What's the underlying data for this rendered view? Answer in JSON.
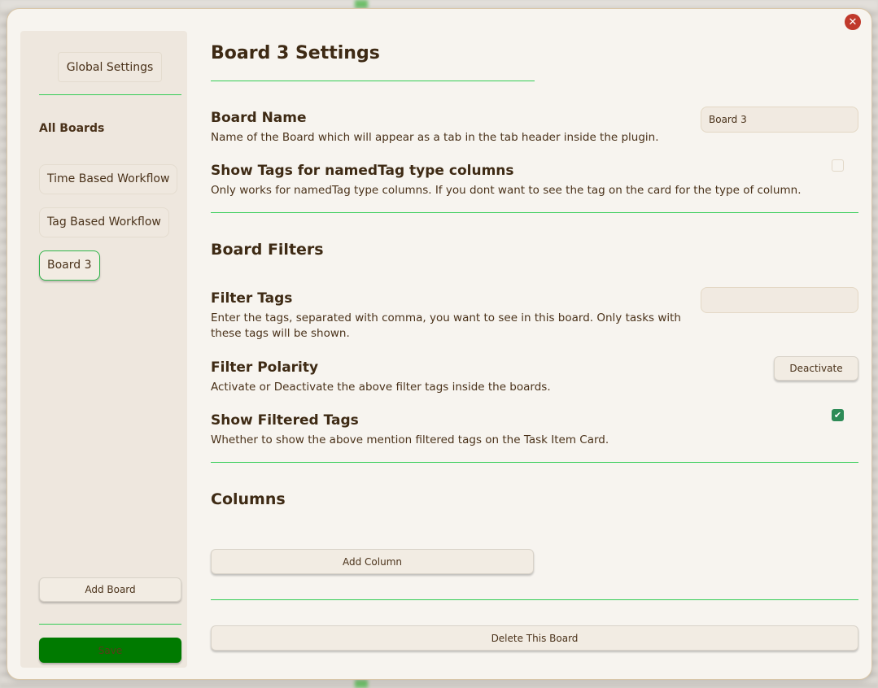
{
  "modal": {
    "close_label": "✕"
  },
  "sidebar": {
    "global_settings_label": "Global Settings",
    "all_boards_heading": "All Boards",
    "boards": [
      {
        "label": "Time Based Workflow",
        "active": false
      },
      {
        "label": "Tag Based Workflow",
        "active": false
      },
      {
        "label": "Board 3",
        "active": true
      }
    ],
    "add_board_label": "Add Board",
    "save_label": "Save"
  },
  "main": {
    "title": "Board 3 Settings",
    "board_name": {
      "name": "Board Name",
      "desc": "Name of the Board which will appear as a tab in the tab header inside the plugin.",
      "value": "Board 3"
    },
    "show_tags": {
      "name": "Show Tags for namedTag type columns",
      "desc": "Only works for namedTag type columns. If you dont want to see the tag on the card for the type of column.",
      "checked": false
    },
    "filters_heading": "Board Filters",
    "filter_tags": {
      "name": "Filter Tags",
      "desc": "Enter the tags, separated with comma, you want to see in this board. Only tasks with these tags will be shown.",
      "value": ""
    },
    "filter_polarity": {
      "name": "Filter Polarity",
      "desc": "Activate or Deactivate the above filter tags inside the boards.",
      "button_label": "Deactivate"
    },
    "show_filtered_tags": {
      "name": "Show Filtered Tags",
      "desc": "Whether to show the above mention filtered tags on the Task Item Card.",
      "checked": true,
      "check_glyph": "✔"
    },
    "columns_heading": "Columns",
    "add_column_label": "Add Column",
    "delete_board_label": "Delete This Board"
  },
  "colors": {
    "accent_divider": "#33cc55",
    "save_button": "#007a00",
    "close_button": "#c0392b",
    "checkbox_checked": "#2e8b57",
    "text": "#4a321a"
  }
}
